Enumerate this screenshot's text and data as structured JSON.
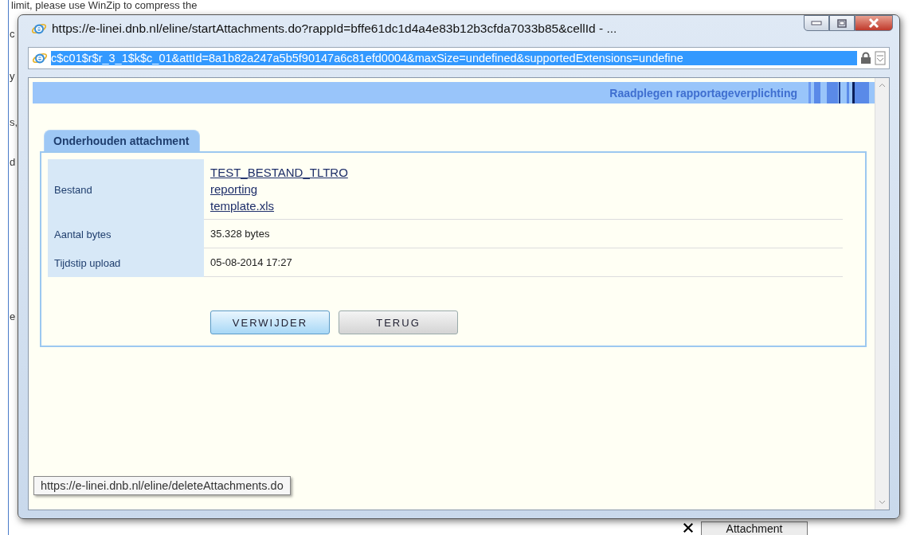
{
  "background_page": {
    "top_text": "limit, please use WinZip to compress the",
    "fragments": [
      "c",
      "y",
      "s,",
      "d",
      "e"
    ],
    "button": "Attachment"
  },
  "window": {
    "title": "https://e-linei.dnb.nl/eline/startAttachments.do?rappId=bffe61dc1d4a4e83b12b3cfda7033b85&cellId - ...",
    "address": "c$c01$r$r_3_1$k$c_01&attId=8a1b82a247a5b5f90147a6c81efd0004&maxSize=undefined&supportedExtensions=undefine"
  },
  "header": {
    "title": "Raadplegen rapportageverplichting"
  },
  "tab": {
    "label": "Onderhouden attachment",
    "selected": true
  },
  "fields": [
    {
      "label": "Bestand",
      "kind": "links",
      "values": [
        "TEST_BESTAND_TLTRO",
        "reporting",
        "template.xls"
      ]
    },
    {
      "label": "Aantal bytes",
      "kind": "text",
      "values": [
        "35.328 bytes"
      ]
    },
    {
      "label": "Tijdstip upload",
      "kind": "text",
      "values": [
        "05-08-2014 17:27"
      ]
    }
  ],
  "buttons": [
    {
      "label": "VERWIJDER",
      "focused": true
    },
    {
      "label": "TERUG",
      "focused": false
    }
  ],
  "tooltip": "https://e-linei.dnb.nl/eline/deleteAttachments.do"
}
